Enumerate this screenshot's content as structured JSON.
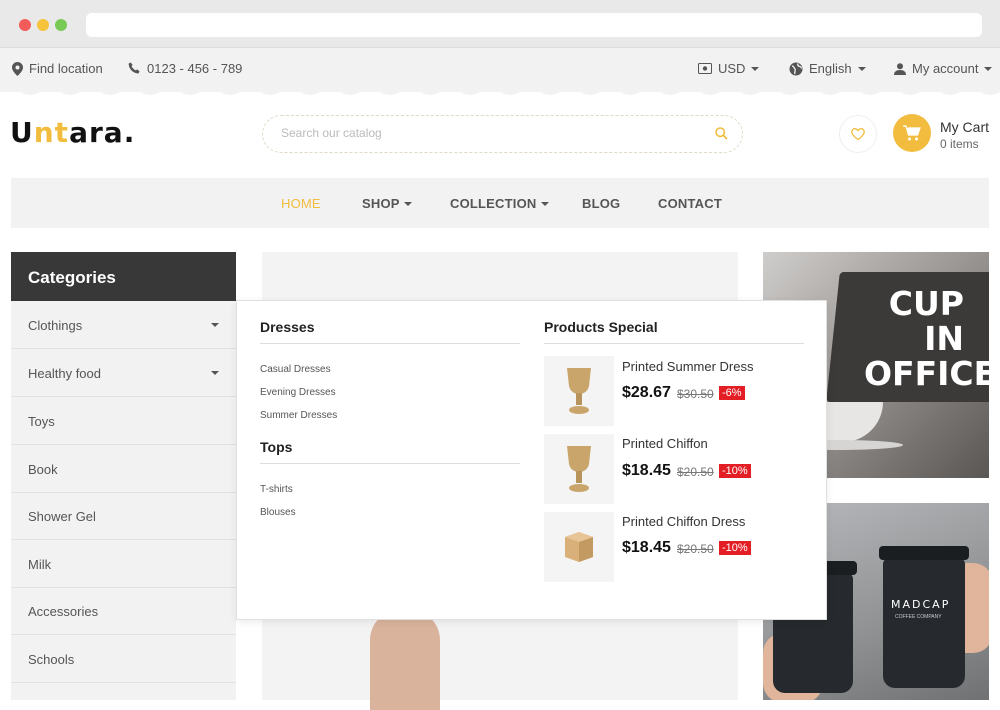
{
  "topbar": {
    "location": "Find location",
    "phone": "0123 - 456 - 789",
    "currency": "USD",
    "language": "English",
    "account": "My account"
  },
  "header": {
    "logo": {
      "part1": "U",
      "part2": "nt",
      "part3": "a",
      "part4": "ra."
    },
    "search_placeholder": "Search our catalog",
    "cart_title": "My Cart",
    "cart_count": "0 items"
  },
  "nav": {
    "items": [
      {
        "label": "HOME",
        "active": true
      },
      {
        "label": "SHOP",
        "dropdown": true
      },
      {
        "label": "COLLECTION",
        "dropdown": true
      },
      {
        "label": "BLOG"
      },
      {
        "label": "CONTACT"
      }
    ]
  },
  "sidebar": {
    "title": "Categories",
    "items": [
      {
        "label": "Clothings",
        "expandable": true
      },
      {
        "label": "Healthy food",
        "expandable": true
      },
      {
        "label": "Toys"
      },
      {
        "label": "Book"
      },
      {
        "label": "Shower Gel"
      },
      {
        "label": "Milk"
      },
      {
        "label": "Accessories"
      },
      {
        "label": "Schools"
      }
    ]
  },
  "mega": {
    "dresses_title": "Dresses",
    "dresses": [
      "Casual Dresses",
      "Evening Dresses",
      "Summer Dresses"
    ],
    "tops_title": "Tops",
    "tops": [
      "T-shirts",
      "Blouses"
    ],
    "special_title": "Products Special",
    "products": [
      {
        "name": "Printed Summer Dress",
        "price": "$28.67",
        "old": "$30.50",
        "discount": "-6%"
      },
      {
        "name": "Printed Chiffon",
        "price": "$18.45",
        "old": "$20.50",
        "discount": "-10%"
      },
      {
        "name": "Printed Chiffon Dress",
        "price": "$18.45",
        "old": "$20.50",
        "discount": "-10%"
      }
    ]
  },
  "banners": {
    "right_top_line1": "CUP IN",
    "right_top_line2": "OFFICES",
    "cup_brand": "MADCAP",
    "cup_sub": "COFFEE COMPANY"
  },
  "colors": {
    "accent": "#f2bc3e",
    "dark": "#383838",
    "discount": "#e31e24"
  }
}
